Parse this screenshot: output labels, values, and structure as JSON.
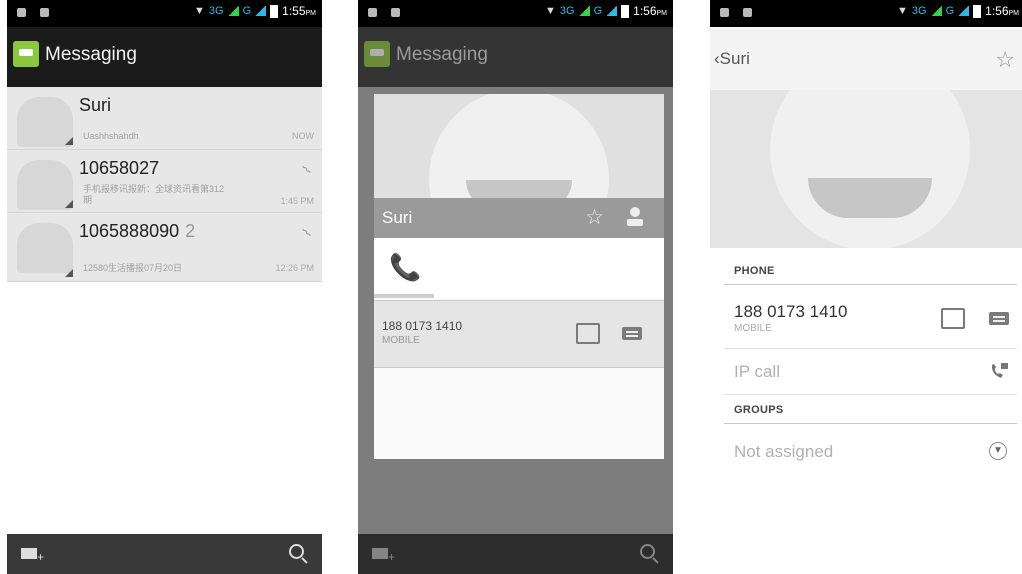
{
  "status": {
    "time1": "1:55",
    "time2": "1:56",
    "time3": "1:56",
    "pm": "PM",
    "network": "3G",
    "network2": "G"
  },
  "messaging": {
    "title": "Messaging",
    "conversations": [
      {
        "name": "Suri",
        "snippet": "Uashhshahdh",
        "time": "NOW",
        "count": ""
      },
      {
        "name": "10658027",
        "snippet": "手机报移讯报新：全球资讯看第312期",
        "time": "1:45 PM",
        "count": ""
      },
      {
        "name": "1065888090",
        "snippet": "12580生活播报07月20日",
        "time": "12:26 PM",
        "count": "2"
      }
    ]
  },
  "quick_contact": {
    "name": "Suri",
    "number": "188 0173 1410",
    "type": "MOBILE"
  },
  "contact_detail": {
    "name": "Suri",
    "phone_header": "PHONE",
    "number": "188 0173 1410",
    "type": "MOBILE",
    "ip_call": "IP call",
    "groups_header": "GROUPS",
    "groups_value": "Not assigned"
  },
  "icons": {
    "compose": "compose-message-icon",
    "search": "search-icon",
    "star": "star-icon",
    "phone": "phone-icon",
    "contact_card": "contact-card-icon",
    "message": "message-icon",
    "ip_call": "ip-call-icon",
    "dropdown": "chevron-down-icon"
  }
}
